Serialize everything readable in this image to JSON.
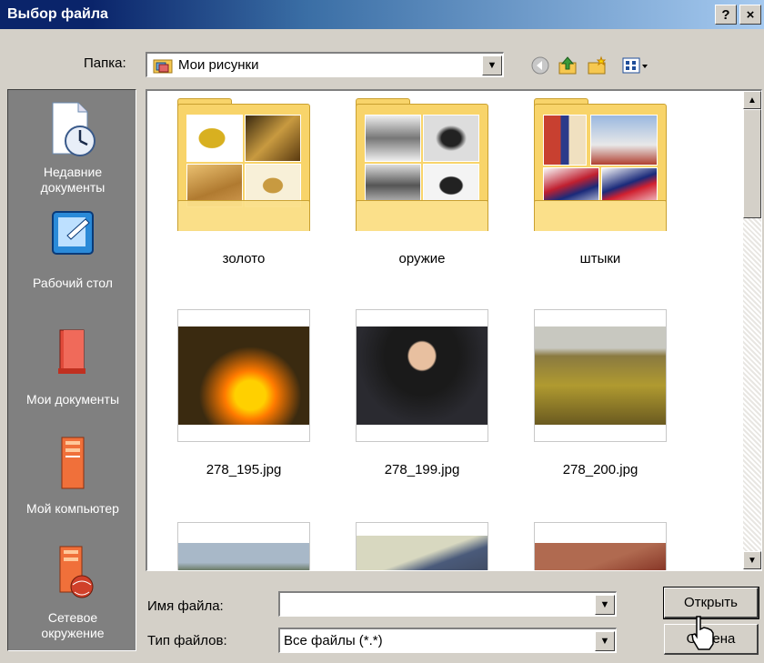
{
  "window": {
    "title": "Выбор файла",
    "help_label": "?",
    "close_label": "×"
  },
  "toolbar": {
    "folder_label": "Папка:",
    "folder_value": "Мои рисунки",
    "icons": [
      "back-icon",
      "up-folder-icon",
      "new-folder-icon",
      "view-menu-icon"
    ]
  },
  "places": [
    {
      "label": "Недавние документы",
      "icon": "recent-documents-icon"
    },
    {
      "label": "Рабочий стол",
      "icon": "desktop-icon"
    },
    {
      "label": "Мои документы",
      "icon": "my-documents-icon"
    },
    {
      "label": "Мой компьютер",
      "icon": "my-computer-icon"
    },
    {
      "label": "Сетевое окружение",
      "icon": "network-icon"
    }
  ],
  "files": [
    {
      "name": "золото",
      "kind": "folder"
    },
    {
      "name": "оружие",
      "kind": "folder"
    },
    {
      "name": "штыки",
      "kind": "folder"
    },
    {
      "name": "278_195.jpg",
      "kind": "image"
    },
    {
      "name": "278_199.jpg",
      "kind": "image"
    },
    {
      "name": "278_200.jpg",
      "kind": "image"
    },
    {
      "name": "",
      "kind": "image"
    },
    {
      "name": "",
      "kind": "image"
    },
    {
      "name": "",
      "kind": "image"
    }
  ],
  "bottom": {
    "filename_label": "Имя файла:",
    "filename_value": "",
    "filetype_label": "Тип файлов:",
    "filetype_value": "Все файлы (*.*)",
    "open_label": "Открыть",
    "cancel_label": "Отмена"
  },
  "colors": {
    "titlebar": "#0a246a",
    "folder": "#f8d46a",
    "places_bg": "#808080",
    "dialog_bg": "#d4d0c8"
  }
}
